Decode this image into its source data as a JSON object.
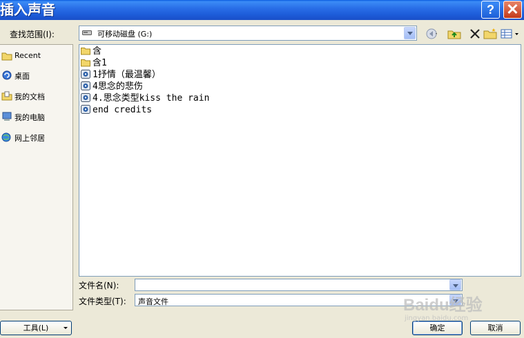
{
  "window": {
    "title": "插入声音",
    "help_label": "?",
    "close_label": "✕"
  },
  "lookin": {
    "label": "查找范围(I):",
    "value": "可移动磁盘 (G:)"
  },
  "toolbar": {
    "icons": [
      "back-icon",
      "up-folder-icon",
      "delete-icon",
      "new-folder-icon",
      "views-icon"
    ]
  },
  "places": [
    {
      "label": "Recent",
      "icon": "recent-folder-icon"
    },
    {
      "label": "桌面",
      "icon": "desktop-icon"
    },
    {
      "label": "我的文档",
      "icon": "my-documents-icon"
    },
    {
      "label": "我的电脑",
      "icon": "my-computer-icon"
    },
    {
      "label": "网上邻居",
      "icon": "network-icon"
    }
  ],
  "files": [
    {
      "name": "含",
      "type": "folder"
    },
    {
      "name": "含1",
      "type": "folder"
    },
    {
      "name": "1抒情（最温馨）",
      "type": "audio"
    },
    {
      "name": "4思念的悲伤",
      "type": "audio"
    },
    {
      "name": "4.思念类型kiss the rain",
      "type": "audio"
    },
    {
      "name": "end credits",
      "type": "audio"
    }
  ],
  "filename": {
    "label": "文件名(N):",
    "value": ""
  },
  "filetype": {
    "label": "文件类型(T):",
    "value": "声音文件"
  },
  "buttons": {
    "tools": "工具(L)",
    "ok": "确定",
    "cancel": "取消"
  },
  "watermark": {
    "brand": "Baidu经验",
    "sub": "jingyan.baidu.com"
  },
  "colors": {
    "titlebar": "#2a6fe8",
    "dialog_bg": "#ece9d8",
    "border": "#7f9db9",
    "folder": "#f2d66a"
  }
}
